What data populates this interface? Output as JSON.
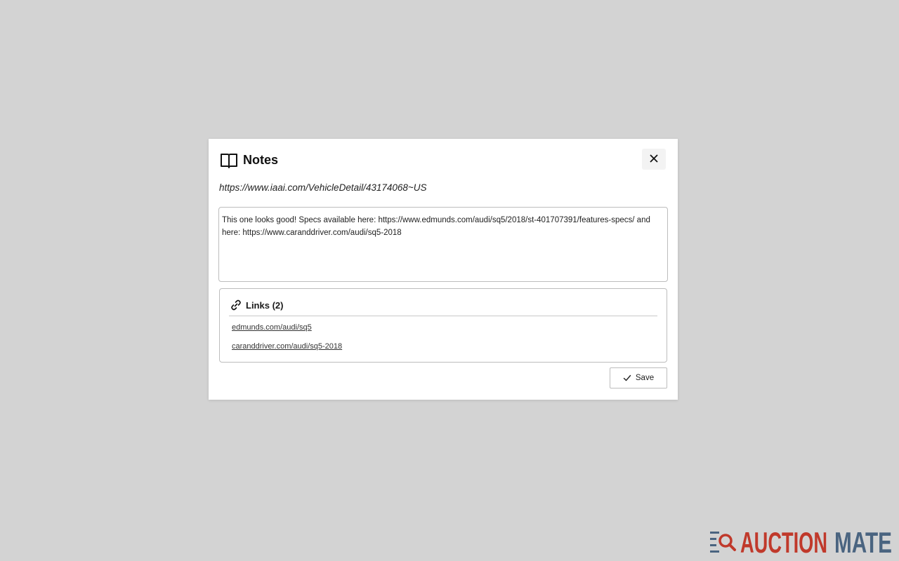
{
  "modal": {
    "title": "Notes",
    "url": "https://www.iaai.com/VehicleDetail/43174068~US",
    "note_text": "This one looks good! Specs available here: https://www.edmunds.com/audi/sq5/2018/st-401707391/features-specs/ and here: https://www.caranddriver.com/audi/sq5-2018",
    "links_title": "Links (2)",
    "links": [
      {
        "label": "edmunds.com/audi/sq5"
      },
      {
        "label": "caranddriver.com/audi/sq5-2018"
      }
    ],
    "save_label": "Save"
  },
  "icons": {
    "title_icon": "book-open-icon",
    "close_icon": "close-icon",
    "links_icon": "link-icon",
    "save_icon": "check-icon",
    "brand_icon": "search-lines-icon"
  },
  "brand": {
    "word1": "AUCTION",
    "word2": "MATE",
    "color1": "#c0392b",
    "color2": "#4a6480"
  },
  "colors": {
    "backdrop": "#d3d3d3",
    "panel": "#ffffff",
    "border": "#bdbdbd"
  }
}
